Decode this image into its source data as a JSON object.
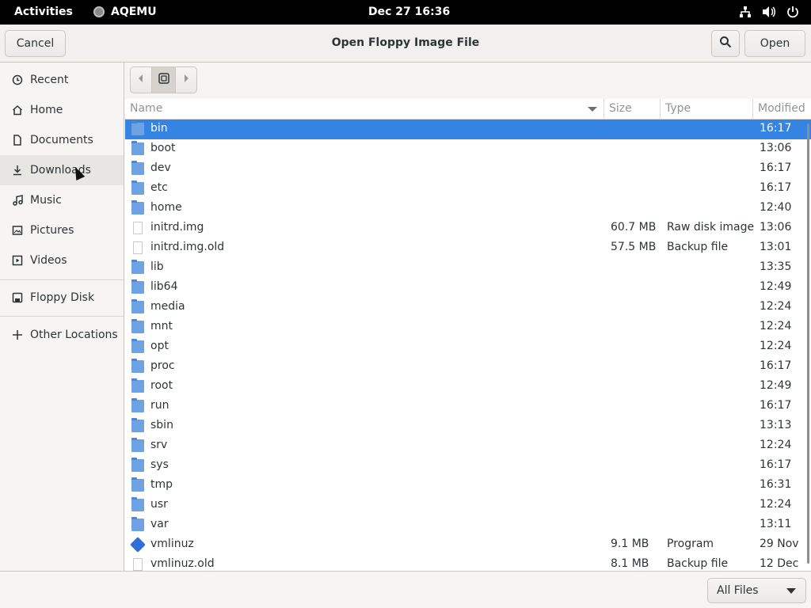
{
  "topbar": {
    "activities": "Activities",
    "app_name": "AQEMU",
    "clock": "Dec 27  16:36",
    "tray_icons": [
      "network-icon",
      "volume-icon",
      "power-icon"
    ]
  },
  "dialog": {
    "title": "Open Floppy Image File",
    "cancel_label": "Cancel",
    "open_label": "Open",
    "search_icon": "search-icon"
  },
  "sidebar": {
    "items": [
      {
        "label": "Recent",
        "icon": "clock-icon"
      },
      {
        "label": "Home",
        "icon": "home-icon"
      },
      {
        "label": "Documents",
        "icon": "document-icon"
      },
      {
        "label": "Downloads",
        "icon": "download-icon"
      },
      {
        "label": "Music",
        "icon": "music-icon"
      },
      {
        "label": "Pictures",
        "icon": "picture-icon"
      },
      {
        "label": "Videos",
        "icon": "video-icon"
      },
      {
        "label": "Floppy Disk",
        "icon": "floppy-icon"
      },
      {
        "label": "Other Locations",
        "icon": "plus-icon"
      }
    ]
  },
  "pathbar": {
    "current": "disk-icon"
  },
  "columns": {
    "name": "Name",
    "size": "Size",
    "type": "Type",
    "modified": "Modified"
  },
  "files": [
    {
      "name": "bin",
      "kind": "folder",
      "size": "",
      "type": "",
      "modified": "16:17",
      "selected": true
    },
    {
      "name": "boot",
      "kind": "folder",
      "size": "",
      "type": "",
      "modified": "13:06"
    },
    {
      "name": "dev",
      "kind": "folder",
      "size": "",
      "type": "",
      "modified": "16:17"
    },
    {
      "name": "etc",
      "kind": "folder",
      "size": "",
      "type": "",
      "modified": "16:17"
    },
    {
      "name": "home",
      "kind": "folder",
      "size": "",
      "type": "",
      "modified": "12:40"
    },
    {
      "name": "initrd.img",
      "kind": "file",
      "size": "60.7 MB",
      "type": "Raw disk image",
      "modified": "13:06"
    },
    {
      "name": "initrd.img.old",
      "kind": "file",
      "size": "57.5 MB",
      "type": "Backup file",
      "modified": "13:01"
    },
    {
      "name": "lib",
      "kind": "folder",
      "size": "",
      "type": "",
      "modified": "13:35"
    },
    {
      "name": "lib64",
      "kind": "folder",
      "size": "",
      "type": "",
      "modified": "12:49"
    },
    {
      "name": "media",
      "kind": "folder",
      "size": "",
      "type": "",
      "modified": "12:24"
    },
    {
      "name": "mnt",
      "kind": "folder",
      "size": "",
      "type": "",
      "modified": "12:24"
    },
    {
      "name": "opt",
      "kind": "folder",
      "size": "",
      "type": "",
      "modified": "12:24"
    },
    {
      "name": "proc",
      "kind": "folder",
      "size": "",
      "type": "",
      "modified": "16:17"
    },
    {
      "name": "root",
      "kind": "folder",
      "size": "",
      "type": "",
      "modified": "12:49"
    },
    {
      "name": "run",
      "kind": "folder",
      "size": "",
      "type": "",
      "modified": "16:17"
    },
    {
      "name": "sbin",
      "kind": "folder",
      "size": "",
      "type": "",
      "modified": "13:13"
    },
    {
      "name": "srv",
      "kind": "folder",
      "size": "",
      "type": "",
      "modified": "12:24"
    },
    {
      "name": "sys",
      "kind": "folder",
      "size": "",
      "type": "",
      "modified": "16:17"
    },
    {
      "name": "tmp",
      "kind": "folder",
      "size": "",
      "type": "",
      "modified": "16:31"
    },
    {
      "name": "usr",
      "kind": "folder",
      "size": "",
      "type": "",
      "modified": "12:24"
    },
    {
      "name": "var",
      "kind": "folder",
      "size": "",
      "type": "",
      "modified": "13:11"
    },
    {
      "name": "vmlinuz",
      "kind": "exe",
      "size": "9.1 MB",
      "type": "Program",
      "modified": "29 Nov"
    },
    {
      "name": "vmlinuz.old",
      "kind": "file",
      "size": "8.1 MB",
      "type": "Backup file",
      "modified": "12 Dec"
    }
  ],
  "filter": {
    "selected": "All Files"
  },
  "colors": {
    "selection": "#3584e4",
    "folder": "#6fa2e3",
    "topbar": "#000000"
  }
}
